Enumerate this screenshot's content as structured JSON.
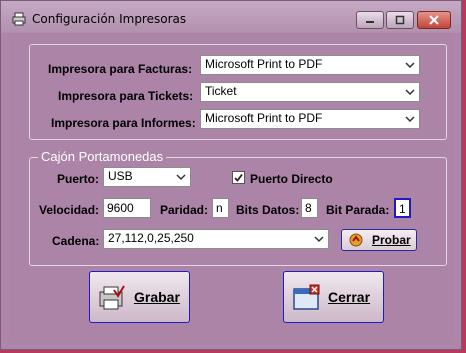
{
  "window": {
    "title": "Configuración Impresoras"
  },
  "printers": {
    "facturas_label": "Impresora para Facturas:",
    "facturas_value": "Microsoft Print to PDF",
    "tickets_label": "Impresora para Tickets:",
    "tickets_value": "Ticket",
    "informes_label": "Impresora para Informes:",
    "informes_value": "Microsoft Print to PDF"
  },
  "cajon": {
    "legend": "Cajón Portamonedas",
    "puerto_label": "Puerto:",
    "puerto_value": "USB",
    "puerto_directo_label": "Puerto Directo",
    "puerto_directo_checked": true,
    "velocidad_label": "Velocidad:",
    "velocidad_value": "9600",
    "paridad_label": "Paridad:",
    "paridad_value": "n",
    "bits_datos_label": "Bits Datos:",
    "bits_datos_value": "8",
    "bit_parada_label": "Bit Parada:",
    "bit_parada_value": "1",
    "cadena_label": "Cadena:",
    "cadena_value": "27,112,0,25,250",
    "probar_label": "Probar"
  },
  "actions": {
    "grabar_label": "Grabar",
    "cerrar_label": "Cerrar"
  },
  "colors": {
    "window_bg": "#ab84a7",
    "desktop": "#b63a5c",
    "accent_border": "#1c1cc0"
  },
  "icons": [
    "printer-icon",
    "minimize-icon",
    "maximize-icon",
    "close-icon",
    "check-icon",
    "chevron-down-icon",
    "probar-icon",
    "save-icon",
    "exit-icon"
  ]
}
